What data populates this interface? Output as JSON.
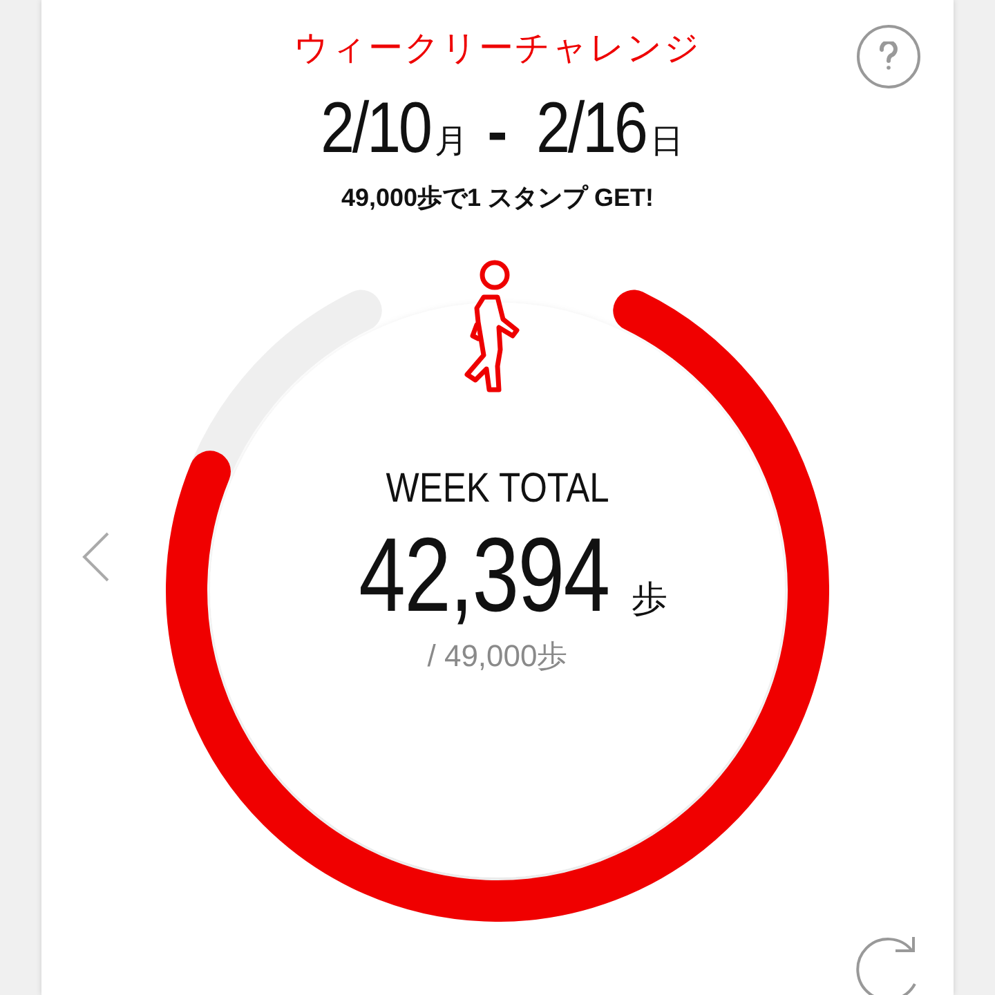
{
  "title": "ウィークリーチャレンジ",
  "date_range": {
    "start": "2/10",
    "start_day": "月",
    "separator": "-",
    "end": "2/16",
    "end_day": "日"
  },
  "goal_text": "49,000歩で1 スタンプ GET!",
  "progress": {
    "label": "WEEK TOTAL",
    "total": "42,394",
    "unit": "歩",
    "goal": "/ 49,000歩"
  }
}
